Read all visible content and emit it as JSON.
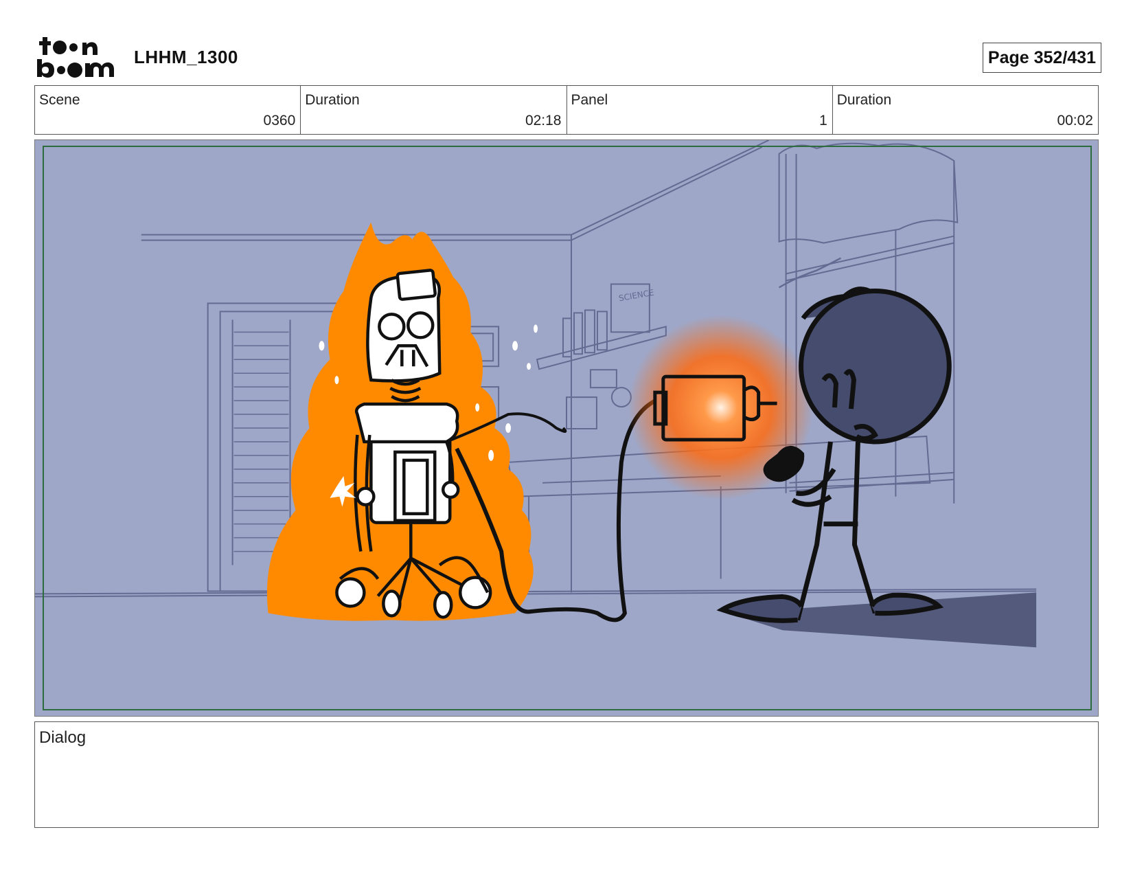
{
  "header": {
    "logo_text": "toon boom",
    "project_title": "LHHM_1300",
    "page_label": "Page 352/431"
  },
  "info": [
    {
      "label": "Scene",
      "value": "0360"
    },
    {
      "label": "Duration",
      "value": "02:18"
    },
    {
      "label": "Panel",
      "value": "1"
    },
    {
      "label": "Duration",
      "value": "00:02"
    }
  ],
  "panel": {
    "background_color": "#9ea7c8",
    "fire_color": "#ff8a00",
    "glow_color": "#ff6a10",
    "shadow_color": "#454c6e",
    "safe_area_color": "#2e6b3d",
    "book_label": "SCIENCE"
  },
  "dialog": {
    "label": "Dialog",
    "text": ""
  }
}
